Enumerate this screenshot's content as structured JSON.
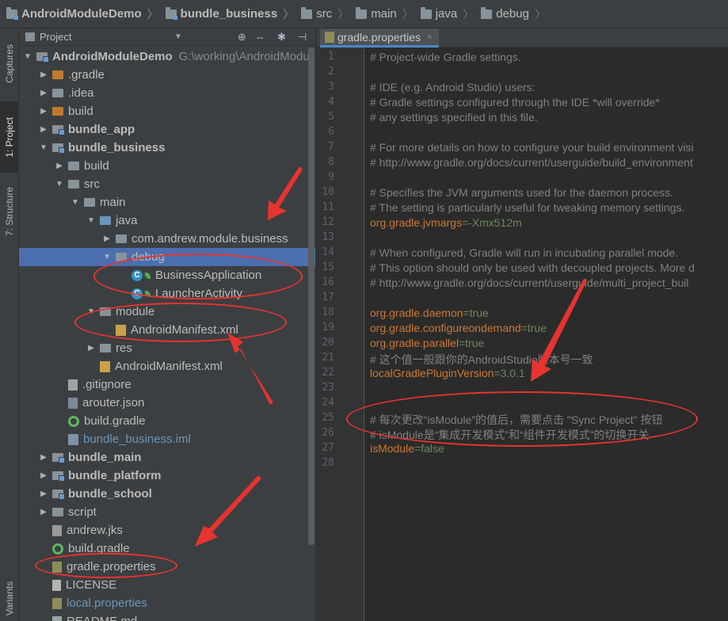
{
  "breadcrumb": [
    {
      "label": "AndroidModuleDemo",
      "bold": true,
      "icon": "module-folder-icon"
    },
    {
      "label": "bundle_business",
      "bold": true,
      "icon": "module-folder-icon"
    },
    {
      "label": "src",
      "bold": false,
      "icon": "folder-icon"
    },
    {
      "label": "main",
      "bold": false,
      "icon": "folder-icon"
    },
    {
      "label": "java",
      "bold": false,
      "icon": "folder-icon"
    },
    {
      "label": "debug",
      "bold": false,
      "icon": "folder-icon"
    }
  ],
  "side_tabs": {
    "captures": "Captures",
    "project": "1: Project",
    "structure": "7: Structure",
    "variants": "Variants"
  },
  "project_panel": {
    "view_selector": "Project",
    "buttons": {
      "sync": "⊕",
      "collapse": "⇔",
      "settings": "✱",
      "hide": "⊣"
    }
  },
  "tree": [
    {
      "label": "AndroidModuleDemo",
      "path": "G:\\working\\AndroidModu",
      "indent": 0,
      "expanded": true,
      "icon": "module",
      "style": "bold"
    },
    {
      "label": ".gradle",
      "indent": 1,
      "expanded": false,
      "icon": "folder-orange",
      "style": ""
    },
    {
      "label": ".idea",
      "indent": 1,
      "expanded": false,
      "icon": "folder",
      "style": ""
    },
    {
      "label": "build",
      "indent": 1,
      "expanded": false,
      "icon": "folder-orange",
      "style": ""
    },
    {
      "label": "bundle_app",
      "indent": 1,
      "expanded": false,
      "icon": "module",
      "style": "bold"
    },
    {
      "label": "bundle_business",
      "indent": 1,
      "expanded": true,
      "icon": "module",
      "style": "bold"
    },
    {
      "label": "build",
      "indent": 2,
      "expanded": false,
      "icon": "folder",
      "style": ""
    },
    {
      "label": "src",
      "indent": 2,
      "expanded": true,
      "icon": "folder",
      "style": ""
    },
    {
      "label": "main",
      "indent": 3,
      "expanded": true,
      "icon": "folder",
      "style": ""
    },
    {
      "label": "java",
      "indent": 4,
      "expanded": true,
      "icon": "folder-src",
      "style": ""
    },
    {
      "label": "com.andrew.module.business",
      "indent": 5,
      "expanded": false,
      "icon": "folder",
      "style": ""
    },
    {
      "label": "debug",
      "indent": 5,
      "expanded": true,
      "icon": "folder",
      "style": "",
      "selected": true
    },
    {
      "label": "BusinessApplication",
      "indent": 6,
      "icon": "class",
      "style": ""
    },
    {
      "label": "LauncherActivity",
      "indent": 6,
      "icon": "class",
      "style": ""
    },
    {
      "label": "module",
      "indent": 4,
      "expanded": true,
      "icon": "folder",
      "style": ""
    },
    {
      "label": "AndroidManifest.xml",
      "indent": 5,
      "icon": "xml",
      "style": ""
    },
    {
      "label": "res",
      "indent": 4,
      "expanded": false,
      "icon": "folder",
      "style": ""
    },
    {
      "label": "AndroidManifest.xml",
      "indent": 4,
      "icon": "xml",
      "style": ""
    },
    {
      "label": ".gitignore",
      "indent": 2,
      "icon": "file",
      "style": ""
    },
    {
      "label": "arouter.json",
      "indent": 2,
      "icon": "json",
      "style": ""
    },
    {
      "label": "build.gradle",
      "indent": 2,
      "icon": "gradle",
      "style": ""
    },
    {
      "label": "bundle_business.iml",
      "indent": 2,
      "icon": "iml",
      "style": "blue"
    },
    {
      "label": "bundle_main",
      "indent": 1,
      "expanded": false,
      "icon": "module",
      "style": "bold"
    },
    {
      "label": "bundle_platform",
      "indent": 1,
      "expanded": false,
      "icon": "module",
      "style": "bold"
    },
    {
      "label": "bundle_school",
      "indent": 1,
      "expanded": false,
      "icon": "module",
      "style": "bold"
    },
    {
      "label": "script",
      "indent": 1,
      "expanded": false,
      "icon": "folder",
      "style": ""
    },
    {
      "label": "andrew.jks",
      "indent": 1,
      "icon": "jks",
      "style": ""
    },
    {
      "label": "build.gradle",
      "indent": 1,
      "icon": "gradle",
      "style": ""
    },
    {
      "label": "gradle.properties",
      "indent": 1,
      "icon": "props",
      "style": ""
    },
    {
      "label": "LICENSE",
      "indent": 1,
      "icon": "lic",
      "style": ""
    },
    {
      "label": "local.properties",
      "indent": 1,
      "icon": "props",
      "style": "blue"
    },
    {
      "label": "README.md",
      "indent": 1,
      "icon": "file",
      "style": ""
    }
  ],
  "editor": {
    "tab_label": "gradle.properties",
    "tab_close": "×",
    "lines": [
      [
        {
          "t": "# Project-wide Gradle settings.",
          "c": "comment"
        }
      ],
      [],
      [
        {
          "t": "# IDE (e.g. Android Studio) users:",
          "c": "comment"
        }
      ],
      [
        {
          "t": "# Gradle settings configured through the IDE *will override*",
          "c": "comment"
        }
      ],
      [
        {
          "t": "# any settings specified in this file.",
          "c": "comment"
        }
      ],
      [],
      [
        {
          "t": "# For more details on how to configure your build environment visi",
          "c": "comment"
        }
      ],
      [
        {
          "t": "# http://www.gradle.org/docs/current/userguide/build_environment",
          "c": "comment"
        }
      ],
      [],
      [
        {
          "t": "# Specifies the JVM arguments used for the daemon process.",
          "c": "comment"
        }
      ],
      [
        {
          "t": "# The setting is particularly useful for tweaking memory settings.",
          "c": "comment"
        }
      ],
      [
        {
          "t": "org.gradle.jvmargs",
          "c": "key"
        },
        {
          "t": "=-Xmx512m",
          "c": "val"
        }
      ],
      [],
      [
        {
          "t": "# When configured, Gradle will run in incubating parallel mode.",
          "c": "comment"
        }
      ],
      [
        {
          "t": "# This option should only be used with decoupled projects. More d",
          "c": "comment"
        }
      ],
      [
        {
          "t": "# http://www.gradle.org/docs/current/userguide/multi_project_buil",
          "c": "comment"
        }
      ],
      [],
      [
        {
          "t": "org.gradle.daemon",
          "c": "key"
        },
        {
          "t": "=true",
          "c": "val"
        }
      ],
      [
        {
          "t": "org.gradle.configureondemand",
          "c": "key"
        },
        {
          "t": "=true",
          "c": "val"
        }
      ],
      [
        {
          "t": "org.gradle.parallel",
          "c": "key"
        },
        {
          "t": "=true",
          "c": "val"
        }
      ],
      [
        {
          "t": "# 这个值一般跟你的AndroidStudio版本号一致",
          "c": "comment"
        }
      ],
      [
        {
          "t": "localGradlePluginVersion",
          "c": "key"
        },
        {
          "t": "=3.0.1",
          "c": "val"
        }
      ],
      [],
      [],
      [
        {
          "t": "# 每次更改“isModule”的值后，需要点击 \"Sync Project\" 按钮",
          "c": "comment"
        }
      ],
      [
        {
          "t": "# isModule是“集成开发模式”和“组件开发模式”的切换开关",
          "c": "comment"
        }
      ],
      [
        {
          "t": "isModule",
          "c": "key"
        },
        {
          "t": "=false",
          "c": "val"
        }
      ],
      []
    ]
  },
  "colors": {
    "annotation_red": "#e8332f",
    "selection": "#4b6eaf",
    "comment": "#808080",
    "property_key": "#cc7832",
    "property_value": "#6a8759"
  }
}
